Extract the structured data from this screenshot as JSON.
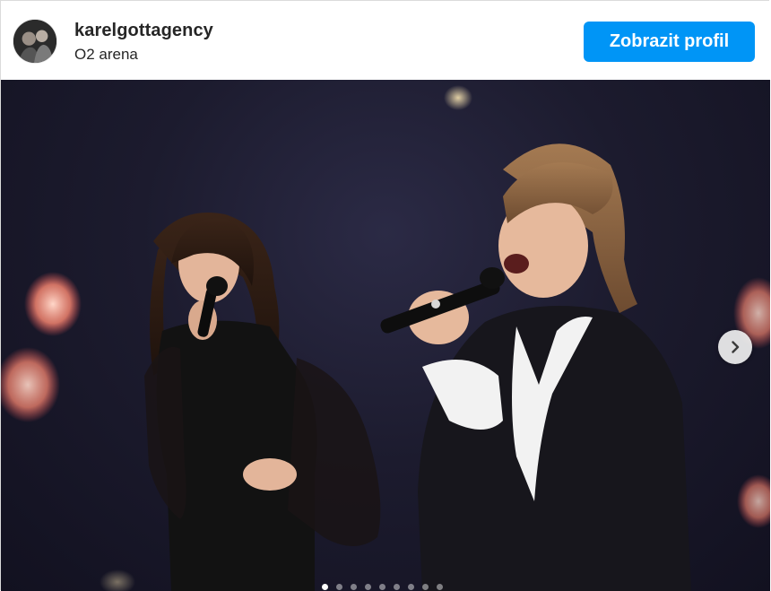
{
  "account": {
    "username": "karelgottagency",
    "location": "O2 arena"
  },
  "actions": {
    "view_profile_label": "Zobrazit profil"
  },
  "carousel": {
    "slide_count": 9,
    "active_index": 0,
    "next_icon": "chevron-right-icon"
  },
  "colors": {
    "button_blue": "#0095f6",
    "stage_background": "#1c1b2e"
  }
}
